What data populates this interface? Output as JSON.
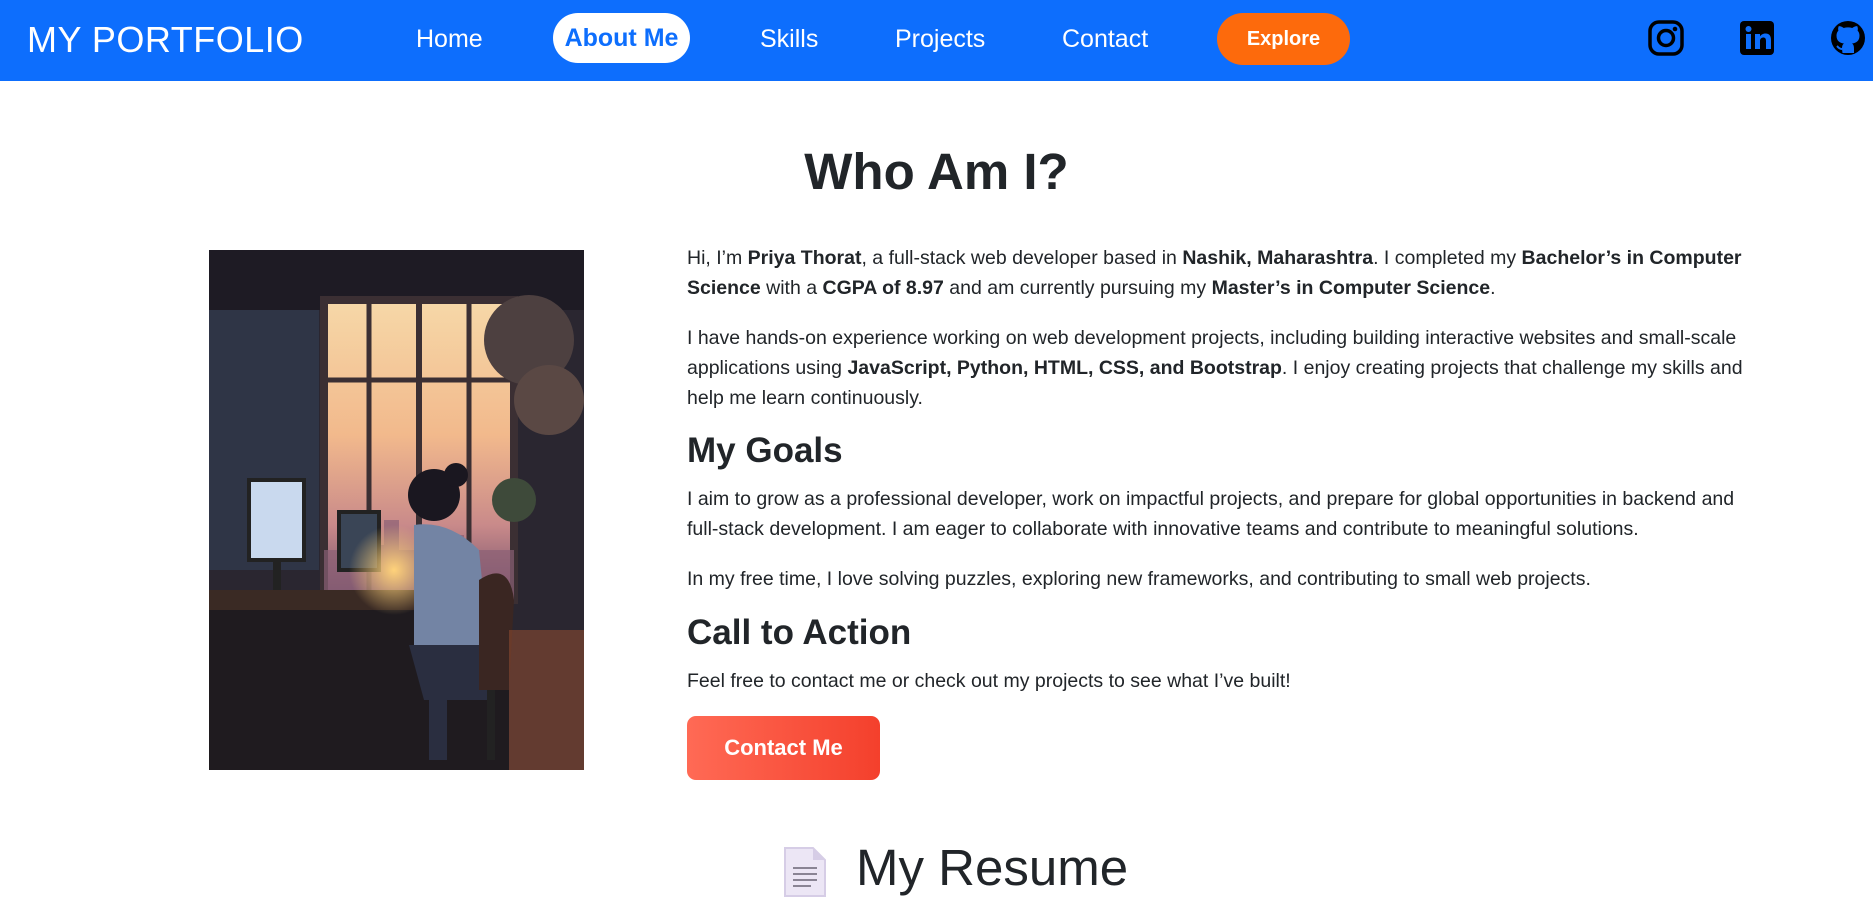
{
  "navbar": {
    "brand": "MY PORTFOLIO",
    "links": [
      "Home",
      "About Me",
      "Skills",
      "Projects",
      "Contact"
    ],
    "active_link": "About Me",
    "explore_label": "Explore",
    "social_icons": [
      "instagram-icon",
      "linkedin-icon",
      "github-icon"
    ]
  },
  "about": {
    "title": "Who Am I?",
    "image_icon": "workspace-illustration",
    "intro": {
      "t1": "Hi, I’m ",
      "name": "Priya Thorat",
      "t2": ", a full-stack web developer based in ",
      "location": "Nashik, Maharashtra",
      "t3": ". I completed my ",
      "degree": "Bachelor’s in Computer Science",
      "t4": " with a ",
      "cgpa": "CGPA of 8.97",
      "t5": " and am currently pursuing my ",
      "masters": "Master’s in Computer Science",
      "t6": "."
    },
    "experience": {
      "t1": "I have hands-on experience working on web development projects, including building interactive websites and small-scale applications using ",
      "tech": "JavaScript, Python, HTML, CSS, and Bootstrap",
      "t2": ". I enjoy creating projects that challenge my skills and help me learn continuously."
    },
    "goals_heading": "My Goals",
    "goals_text": "I aim to grow as a professional developer, work on impactful projects, and prepare for global opportunities in backend and full-stack development. I am eager to collaborate with innovative teams and contribute to meaningful solutions.",
    "free_time_text": "In my free time, I love solving puzzles, exploring new frameworks, and contributing to small web projects.",
    "cta_heading": "Call to Action",
    "cta_text": "Feel free to contact me or check out my projects to see what I’ve built!",
    "contact_button": "Contact Me"
  },
  "resume": {
    "icon": "document-icon",
    "title": "My Resume"
  },
  "colors": {
    "navbar": "#0d6efd",
    "explore": "#fd6a0c",
    "contact_button": "#f4402c"
  }
}
